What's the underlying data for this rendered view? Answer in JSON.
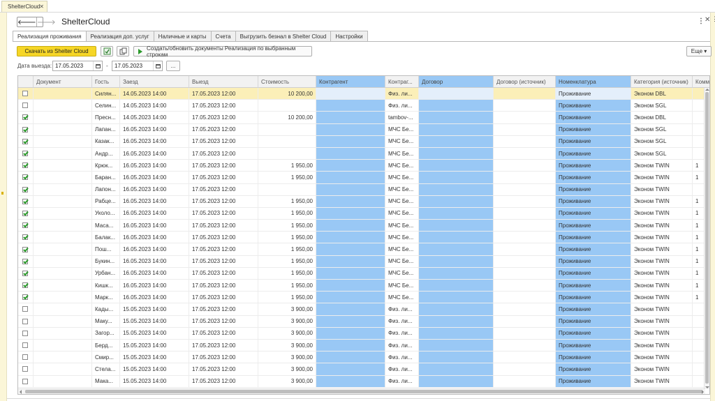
{
  "doc_tab": {
    "label": "ShelterCloud"
  },
  "form_title": "ShelterCloud",
  "tabs": [
    {
      "label": "Реализация проживания",
      "active": true
    },
    {
      "label": "Реализация доп. услуг"
    },
    {
      "label": "Наличные и карты"
    },
    {
      "label": "Счета"
    },
    {
      "label": "Выгрузить безнал в Shelter Cloud"
    },
    {
      "label": "Настройки"
    }
  ],
  "toolbar": {
    "download_label": "Скачать из Shelter Cloud",
    "create_label": "Создать/обновить документы Реализация по выбранным строкам",
    "more_label": "Еще ▾"
  },
  "filter": {
    "label": "Дата выезда:",
    "date_from": "17.05.2023",
    "dash": "-",
    "date_to": "17.05.2023",
    "dots": "..."
  },
  "table": {
    "headers": [
      "",
      "Документ",
      "Гость",
      "Заезд",
      "Выезд",
      "Стоимость",
      "Контрагент",
      "Контраг...",
      "Договор",
      "Договор (источник)",
      "Номенклатура",
      "Категория (источник)",
      "Комм..."
    ],
    "rows": [
      {
        "checked": false,
        "doc": "",
        "guest": "Силян...",
        "checkin": "14.05.2023 14:00",
        "checkout": "17.05.2023 12:00",
        "cost": "10 200,00",
        "cp": "",
        "cp_src": "Физ. ли...",
        "contract": "",
        "contract_src": "",
        "nom": "Проживание",
        "cat": "Эконом DBL",
        "comm": ""
      },
      {
        "checked": false,
        "doc": "",
        "guest": "Селин...",
        "checkin": "14.05.2023 14:00",
        "checkout": "17.05.2023 12:00",
        "cost": "",
        "cp": "",
        "cp_src": "Физ. ли...",
        "contract": "",
        "contract_src": "",
        "nom": "Проживание",
        "cat": "Эконом SGL",
        "comm": ""
      },
      {
        "checked": true,
        "doc": "",
        "guest": "Пресн...",
        "checkin": "14.05.2023 14:00",
        "checkout": "17.05.2023 12:00",
        "cost": "10 200,00",
        "cp": "",
        "cp_src": "tambov-...",
        "contract": "",
        "contract_src": "",
        "nom": "Проживание",
        "cat": "Эконом DBL",
        "comm": ""
      },
      {
        "checked": true,
        "doc": "",
        "guest": "Лапан...",
        "checkin": "16.05.2023 14:00",
        "checkout": "17.05.2023 12:00",
        "cost": "",
        "cp": "",
        "cp_src": "МЧС Бе...",
        "contract": "",
        "contract_src": "",
        "nom": "Проживание",
        "cat": "Эконом SGL",
        "comm": ""
      },
      {
        "checked": true,
        "doc": "",
        "guest": "Казак...",
        "checkin": "16.05.2023 14:00",
        "checkout": "17.05.2023 12:00",
        "cost": "",
        "cp": "",
        "cp_src": "МЧС Бе...",
        "contract": "",
        "contract_src": "",
        "nom": "Проживание",
        "cat": "Эконом SGL",
        "comm": ""
      },
      {
        "checked": true,
        "doc": "",
        "guest": "Андр...",
        "checkin": "16.05.2023 14:00",
        "checkout": "17.05.2023 12:00",
        "cost": "",
        "cp": "",
        "cp_src": "МЧС Бе...",
        "contract": "",
        "contract_src": "",
        "nom": "Проживание",
        "cat": "Эконом SGL",
        "comm": ""
      },
      {
        "checked": true,
        "doc": "",
        "guest": "Крюк...",
        "checkin": "16.05.2023 14:00",
        "checkout": "17.05.2023 12:00",
        "cost": "1 950,00",
        "cp": "",
        "cp_src": "МЧС Бе...",
        "contract": "",
        "contract_src": "",
        "nom": "Проживание",
        "cat": "Эконом TWIN",
        "comm": "1"
      },
      {
        "checked": true,
        "doc": "",
        "guest": "Баран...",
        "checkin": "16.05.2023 14:00",
        "checkout": "17.05.2023 12:00",
        "cost": "1 950,00",
        "cp": "",
        "cp_src": "МЧС Бе...",
        "contract": "",
        "contract_src": "",
        "nom": "Проживание",
        "cat": "Эконом TWIN",
        "comm": "1"
      },
      {
        "checked": true,
        "doc": "",
        "guest": "Лапон...",
        "checkin": "16.05.2023 14:00",
        "checkout": "17.05.2023 12:00",
        "cost": "",
        "cp": "",
        "cp_src": "МЧС Бе...",
        "contract": "",
        "contract_src": "",
        "nom": "Проживание",
        "cat": "Эконом TWIN",
        "comm": ""
      },
      {
        "checked": true,
        "doc": "",
        "guest": "Рабце...",
        "checkin": "16.05.2023 14:00",
        "checkout": "17.05.2023 12:00",
        "cost": "1 950,00",
        "cp": "",
        "cp_src": "МЧС Бе...",
        "contract": "",
        "contract_src": "",
        "nom": "Проживание",
        "cat": "Эконом TWIN",
        "comm": "1"
      },
      {
        "checked": true,
        "doc": "",
        "guest": "Уколо...",
        "checkin": "16.05.2023 14:00",
        "checkout": "17.05.2023 12:00",
        "cost": "1 950,00",
        "cp": "",
        "cp_src": "МЧС Бе...",
        "contract": "",
        "contract_src": "",
        "nom": "Проживание",
        "cat": "Эконом TWIN",
        "comm": "1"
      },
      {
        "checked": true,
        "doc": "",
        "guest": "Маса...",
        "checkin": "16.05.2023 14:00",
        "checkout": "17.05.2023 12:00",
        "cost": "1 950,00",
        "cp": "",
        "cp_src": "МЧС Бе...",
        "contract": "",
        "contract_src": "",
        "nom": "Проживание",
        "cat": "Эконом TWIN",
        "comm": "1"
      },
      {
        "checked": true,
        "doc": "",
        "guest": "Балак...",
        "checkin": "16.05.2023 14:00",
        "checkout": "17.05.2023 12:00",
        "cost": "1 950,00",
        "cp": "",
        "cp_src": "МЧС Бе...",
        "contract": "",
        "contract_src": "",
        "nom": "Проживание",
        "cat": "Эконом TWIN",
        "comm": "1"
      },
      {
        "checked": true,
        "doc": "",
        "guest": "Пош...",
        "checkin": "16.05.2023 14:00",
        "checkout": "17.05.2023 12:00",
        "cost": "1 950,00",
        "cp": "",
        "cp_src": "МЧС Бе...",
        "contract": "",
        "contract_src": "",
        "nom": "Проживание",
        "cat": "Эконом TWIN",
        "comm": "1"
      },
      {
        "checked": true,
        "doc": "",
        "guest": "Букин...",
        "checkin": "16.05.2023 14:00",
        "checkout": "17.05.2023 12:00",
        "cost": "1 950,00",
        "cp": "",
        "cp_src": "МЧС Бе...",
        "contract": "",
        "contract_src": "",
        "nom": "Проживание",
        "cat": "Эконом TWIN",
        "comm": "1"
      },
      {
        "checked": true,
        "doc": "",
        "guest": "Урбан...",
        "checkin": "16.05.2023 14:00",
        "checkout": "17.05.2023 12:00",
        "cost": "1 950,00",
        "cp": "",
        "cp_src": "МЧС Бе...",
        "contract": "",
        "contract_src": "",
        "nom": "Проживание",
        "cat": "Эконом TWIN",
        "comm": "1"
      },
      {
        "checked": true,
        "doc": "",
        "guest": "Кишк...",
        "checkin": "16.05.2023 14:00",
        "checkout": "17.05.2023 12:00",
        "cost": "1 950,00",
        "cp": "",
        "cp_src": "МЧС Бе...",
        "contract": "",
        "contract_src": "",
        "nom": "Проживание",
        "cat": "Эконом TWIN",
        "comm": "1"
      },
      {
        "checked": true,
        "doc": "",
        "guest": "Марк...",
        "checkin": "16.05.2023 14:00",
        "checkout": "17.05.2023 12:00",
        "cost": "1 950,00",
        "cp": "",
        "cp_src": "МЧС Бе...",
        "contract": "",
        "contract_src": "",
        "nom": "Проживание",
        "cat": "Эконом TWIN",
        "comm": "1"
      },
      {
        "checked": false,
        "doc": "",
        "guest": "Кады...",
        "checkin": "15.05.2023 14:00",
        "checkout": "17.05.2023 12:00",
        "cost": "3 900,00",
        "cp": "",
        "cp_src": "Физ. ли...",
        "contract": "",
        "contract_src": "",
        "nom": "Проживание",
        "cat": "Эконом TWIN",
        "comm": ""
      },
      {
        "checked": false,
        "doc": "",
        "guest": "Маку...",
        "checkin": "15.05.2023 14:00",
        "checkout": "17.05.2023 12:00",
        "cost": "3 900,00",
        "cp": "",
        "cp_src": "Физ. ли...",
        "contract": "",
        "contract_src": "",
        "nom": "Проживание",
        "cat": "Эконом TWIN",
        "comm": ""
      },
      {
        "checked": false,
        "doc": "",
        "guest": "Загор...",
        "checkin": "15.05.2023 14:00",
        "checkout": "17.05.2023 12:00",
        "cost": "3 900,00",
        "cp": "",
        "cp_src": "Физ. ли...",
        "contract": "",
        "contract_src": "",
        "nom": "Проживание",
        "cat": "Эконом TWIN",
        "comm": ""
      },
      {
        "checked": false,
        "doc": "",
        "guest": "Берд...",
        "checkin": "15.05.2023 14:00",
        "checkout": "17.05.2023 12:00",
        "cost": "3 900,00",
        "cp": "",
        "cp_src": "Физ. ли...",
        "contract": "",
        "contract_src": "",
        "nom": "Проживание",
        "cat": "Эконом TWIN",
        "comm": ""
      },
      {
        "checked": false,
        "doc": "",
        "guest": "Смир...",
        "checkin": "15.05.2023 14:00",
        "checkout": "17.05.2023 12:00",
        "cost": "3 900,00",
        "cp": "",
        "cp_src": "Физ. ли...",
        "contract": "",
        "contract_src": "",
        "nom": "Проживание",
        "cat": "Эконом TWIN",
        "comm": ""
      },
      {
        "checked": false,
        "doc": "",
        "guest": "Стела...",
        "checkin": "15.05.2023 14:00",
        "checkout": "17.05.2023 12:00",
        "cost": "3 900,00",
        "cp": "",
        "cp_src": "Физ. ли...",
        "contract": "",
        "contract_src": "",
        "nom": "Проживание",
        "cat": "Эконом TWIN",
        "comm": ""
      },
      {
        "checked": false,
        "doc": "",
        "guest": "Мака...",
        "checkin": "15.05.2023 14:00",
        "checkout": "17.05.2023 12:00",
        "cost": "3 900,00",
        "cp": "",
        "cp_src": "Физ. ли...",
        "contract": "",
        "contract_src": "",
        "nom": "Проживание",
        "cat": "Эконом TWIN",
        "comm": ""
      }
    ]
  },
  "colors": {
    "accent_yellow": "#f6d626",
    "column_blue": "#99c8f5",
    "selected_row": "#fbefb8",
    "check_green": "#2a9a2a"
  },
  "icons": {
    "back": "arrow-left-icon",
    "forward": "arrow-right-icon",
    "kebab": "kebab-menu-icon",
    "close": "close-icon",
    "calendar": "calendar-icon",
    "play": "play-icon"
  }
}
